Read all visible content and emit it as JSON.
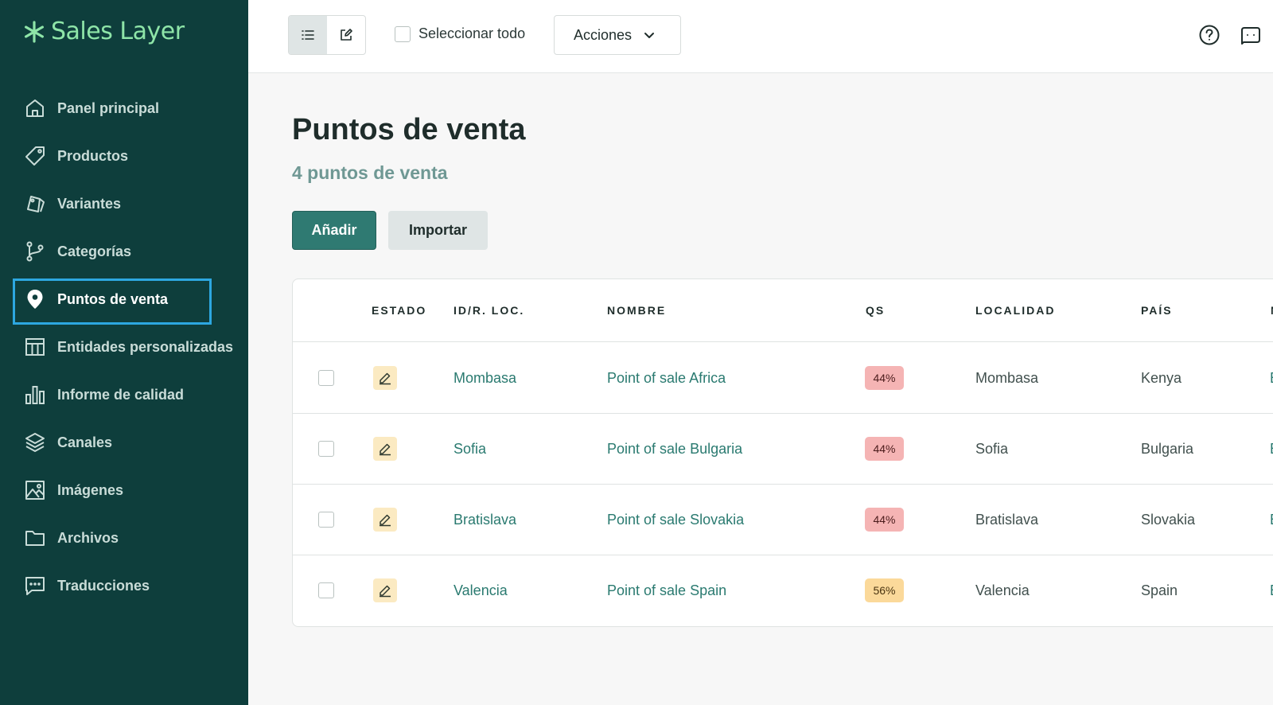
{
  "brand": {
    "name": "Sales Layer",
    "accent": "#8ee5a8",
    "sidebar_bg": "#0e3e3c"
  },
  "sidebar": {
    "items": [
      {
        "label": "Panel principal",
        "icon": "home-icon",
        "active": false
      },
      {
        "label": "Productos",
        "icon": "tag-icon",
        "active": false
      },
      {
        "label": "Variantes",
        "icon": "tags-icon",
        "active": false
      },
      {
        "label": "Categorías",
        "icon": "git-branch-icon",
        "active": false
      },
      {
        "label": "Puntos de venta",
        "icon": "map-pin-icon",
        "active": true
      },
      {
        "label": "Entidades personalizadas",
        "icon": "table-columns-icon",
        "active": false
      },
      {
        "label": "Informe de calidad",
        "icon": "bar-chart-icon",
        "active": false
      },
      {
        "label": "Canales",
        "icon": "layers-icon",
        "active": false
      },
      {
        "label": "Imágenes",
        "icon": "image-icon",
        "active": false
      },
      {
        "label": "Archivos",
        "icon": "folder-icon",
        "active": false
      },
      {
        "label": "Traducciones",
        "icon": "message-icon",
        "active": false
      }
    ]
  },
  "toolbar": {
    "select_all_label": "Seleccionar todo",
    "actions_label": "Acciones"
  },
  "main": {
    "title": "Puntos de venta",
    "subtitle": "4 puntos de venta",
    "add_label": "Añadir",
    "import_label": "Importar"
  },
  "table": {
    "headers": [
      "ESTADO",
      "ID/R. LOC.",
      "NOMBRE",
      "QS",
      "LOCALIDAD",
      "PAÍS",
      "N"
    ],
    "rows": [
      {
        "id": "Mombasa",
        "name": "Point of sale Africa",
        "qs": "44%",
        "qs_level": "red",
        "locality": "Mombasa",
        "country": "Kenya",
        "trunc": "E"
      },
      {
        "id": "Sofia",
        "name": "Point of sale Bulgaria",
        "qs": "44%",
        "qs_level": "red",
        "locality": "Sofia",
        "country": "Bulgaria",
        "trunc": "E"
      },
      {
        "id": "Bratislava",
        "name": "Point of sale Slovakia",
        "qs": "44%",
        "qs_level": "red",
        "locality": "Bratislava",
        "country": "Slovakia",
        "trunc": "E"
      },
      {
        "id": "Valencia",
        "name": "Point of sale Spain",
        "qs": "56%",
        "qs_level": "orange",
        "locality": "Valencia",
        "country": "Spain",
        "trunc": "E"
      }
    ]
  }
}
